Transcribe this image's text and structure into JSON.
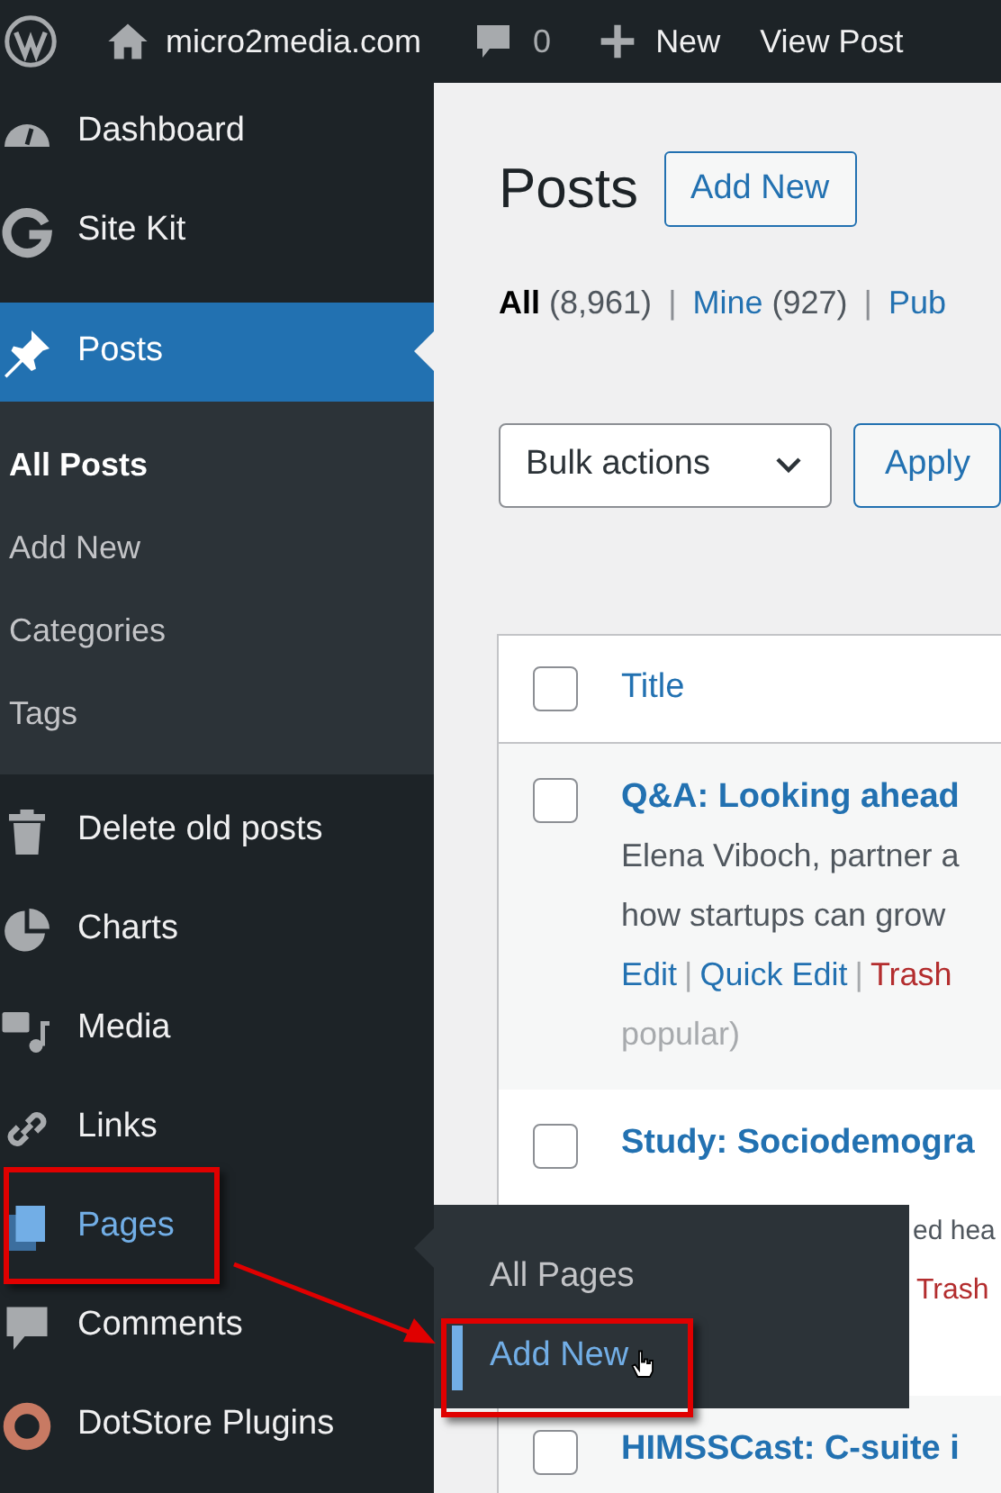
{
  "admin_bar": {
    "site": "micro2media.com",
    "comments": "0",
    "new": "New",
    "view": "View Post"
  },
  "sidebar": {
    "items": [
      {
        "label": "Dashboard",
        "kind": "gauge",
        "current": false
      },
      {
        "label": "Site Kit",
        "kind": "g",
        "current": false
      },
      {
        "label": "Posts",
        "kind": "pin",
        "current": true,
        "children": [
          {
            "label": "All Posts",
            "selected": true
          },
          {
            "label": "Add New",
            "selected": false
          },
          {
            "label": "Categories",
            "selected": false
          },
          {
            "label": "Tags",
            "selected": false
          }
        ]
      },
      {
        "label": "Delete old posts",
        "kind": "trash",
        "current": false
      },
      {
        "label": "Charts",
        "kind": "pie",
        "current": false
      },
      {
        "label": "Media",
        "kind": "media",
        "current": false
      },
      {
        "label": "Links",
        "kind": "link",
        "current": false
      },
      {
        "label": "Pages",
        "kind": "page",
        "current": false,
        "hover": true,
        "highlight": true
      },
      {
        "label": "Comments",
        "kind": "comment",
        "current": false
      },
      {
        "label": "DotStore Plugins",
        "kind": "ring",
        "current": false
      }
    ]
  },
  "flyout": {
    "items": [
      {
        "label": "All Pages",
        "selected": false,
        "highlight": false
      },
      {
        "label": "Add New",
        "selected": true,
        "highlight": true
      }
    ]
  },
  "annotation_arrow": true,
  "page": {
    "title": "Posts",
    "add_button": "Add New",
    "filters": [
      {
        "label": "All",
        "count": "(8,961)",
        "selected": true,
        "sep": "|"
      },
      {
        "label": "Mine",
        "count": "(927)",
        "selected": false,
        "sep": "|"
      },
      {
        "label": "Pub",
        "selected": false
      }
    ],
    "bulk": "Bulk actions",
    "apply": "Apply"
  },
  "table": {
    "select_all": {
      "checked": false
    },
    "columns": [
      "Title"
    ],
    "rows": [
      {
        "title": "Q&A: Looking ahead",
        "lines": [
          "Elena Viboch, partner a",
          "how startups can grow"
        ],
        "actions": [
          {
            "label": "Edit",
            "sep": "|"
          },
          {
            "label": "Quick Edit",
            "sep": "|"
          },
          {
            "label": "Trash"
          }
        ],
        "note": "popular)",
        "checked": false
      },
      {
        "title": "Study: Sociodemogra",
        "lines": [],
        "tail": "ed hea",
        "actions": [
          {
            "label": "Trash"
          }
        ],
        "checked": false
      },
      {
        "title": "HIMSSCast: C-suite i",
        "lines": [],
        "actions": [],
        "checked": false
      }
    ]
  }
}
